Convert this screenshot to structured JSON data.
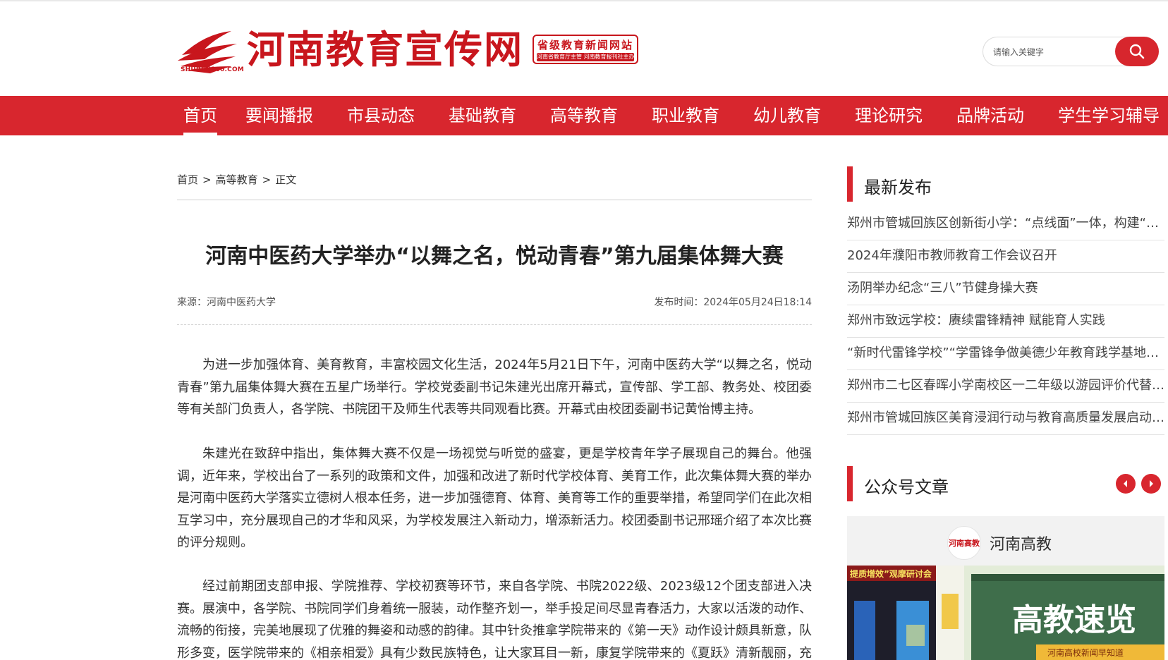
{
  "header": {
    "logo_title": "河南教育宣传网",
    "logo_domain": "SHUREN100.COM",
    "badge_top": "省级教育新闻网站",
    "badge_bottom": "河南省教育厅主管  河南教育报刊社主办"
  },
  "search": {
    "placeholder": "请输入关键字"
  },
  "nav": {
    "items": [
      "首页",
      "要闻播报",
      "市县动态",
      "基础教育",
      "高等教育",
      "职业教育",
      "幼儿教育",
      "理论研究",
      "品牌活动",
      "学生学习辅导"
    ]
  },
  "breadcrumb": {
    "home": "首页",
    "section": "高等教育",
    "current": "正文",
    "separator": ">"
  },
  "article": {
    "title": "河南中医药大学举办“以舞之名，悦动青春”第九届集体舞大赛",
    "source": "来源：河南中医药大学",
    "published": "发布时间：2024年05月24日18:14",
    "paragraphs": [
      "为进一步加强体育、美育教育，丰富校园文化生活，2024年5月21日下午，河南中医药大学“以舞之名，悦动青春”第九届集体舞大赛在五星广场举行。学校党委副书记朱建光出席开幕式，宣传部、学工部、教务处、校团委等有关部门负责人，各学院、书院团干及师生代表等共同观看比赛。开幕式由校团委副书记黄怡博主持。",
      "朱建光在致辞中指出，集体舞大赛不仅是一场视觉与听觉的盛宴，更是学校青年学子展现自己的舞台。他强调，近年来，学校出台了一系列的政策和文件，加强和改进了新时代学校体育、美育工作，此次集体舞大赛的举办是河南中医药大学落实立德树人根本任务，进一步加强德育、体育、美育等工作的重要举措，希望同学们在此次相互学习中，充分展现自己的才华和风采，为学校发展注入新动力，增添新活力。校团委副书记邢瑶介绍了本次比赛的评分规则。",
      "经过前期团支部申报、学院推荐、学校初赛等环节，来自各学院、书院2022级、2023级12个团支部进入决赛。展演中，各学院、书院同学们身着统一服装，动作整齐划一，举手投足间尽显青春活力，大家以活泼的动作、流畅的衔接，完美地展现了优雅的舞姿和动感的韵律。其中针灸推拿学院带来的《第一天》动作设计颇具新意，队形多变，医学院带来的《相亲相爱》具有少数民族特色，让大家耳目一新，康复学院带来的《夏跃》清新靓丽，充"
    ]
  },
  "sidebar": {
    "latest_title": "最新发布",
    "latest_items": [
      "郑州市管城回族区创新街小学：“点线面”一体，构建“大思政”育人新格局",
      "2024年濮阳市教师教育工作会议召开",
      "汤阴举办纪念“三八”节健身操大赛",
      "郑州市致远学校：赓续雷锋精神 赋能育人实践",
      "“新时代雷锋学校”“学雷锋争做美德少年教育践学基地”授牌",
      "郑州市二七区春晖小学南校区一二年级以游园评价代替期末纸笔测试",
      "郑州市管城回族区美育浸润行动与教育高质量发展启动仪式举行"
    ],
    "wechat_title": "公众号文章",
    "wechat_account": "河南高教",
    "wechat_avatar_text": "河南高教",
    "wechat_banner": "高教速览",
    "wechat_banner_sub": "河南高校新闻早知道",
    "wechat_left_caption": "提质增效”观摩研讨会"
  },
  "colors": {
    "brand_red": "#d8262e",
    "logo_red": "#c8161d"
  }
}
